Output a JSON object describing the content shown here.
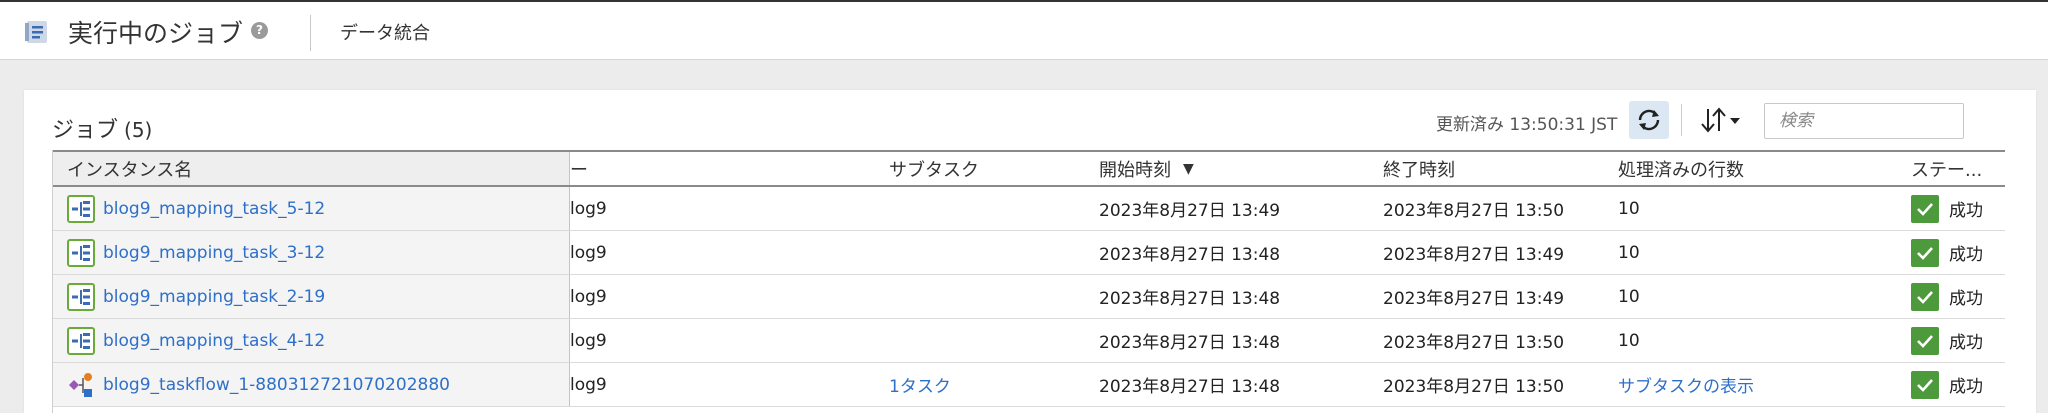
{
  "header": {
    "title": "実行中のジョブ",
    "help_icon": "?",
    "app_name": "データ統合"
  },
  "panel": {
    "title": "ジョブ",
    "count": "(5)",
    "updated": "更新済み 13:50:31 JST",
    "search_placeholder": "検索"
  },
  "columns": {
    "instance_name": "インスタンス名",
    "location": "ー",
    "subtask": "サブタスク",
    "start_time": "開始時刻",
    "end_time": "終了時刻",
    "rows_processed": "処理済みの行数",
    "status": "ステー..."
  },
  "rows": [
    {
      "name": "blog9_mapping_task_5-12",
      "location": "log9",
      "subtask": "",
      "start": "2023年8月27日 13:49",
      "end": "2023年8月27日 13:50",
      "rows": "10",
      "status": "成功",
      "icon": "mapping-task-icon"
    },
    {
      "name": "blog9_mapping_task_3-12",
      "location": "log9",
      "subtask": "",
      "start": "2023年8月27日 13:48",
      "end": "2023年8月27日 13:49",
      "rows": "10",
      "status": "成功",
      "icon": "mapping-task-icon"
    },
    {
      "name": "blog9_mapping_task_2-19",
      "location": "log9",
      "subtask": "",
      "start": "2023年8月27日 13:48",
      "end": "2023年8月27日 13:49",
      "rows": "10",
      "status": "成功",
      "icon": "mapping-task-icon"
    },
    {
      "name": "blog9_mapping_task_4-12",
      "location": "log9",
      "subtask": "",
      "start": "2023年8月27日 13:48",
      "end": "2023年8月27日 13:50",
      "rows": "10",
      "status": "成功",
      "icon": "mapping-task-icon"
    },
    {
      "name": "blog9_taskflow_1-880312721070202880",
      "location": "log9",
      "subtask": "1タスク",
      "start": "2023年8月27日 13:48",
      "end": "2023年8月27日 13:50",
      "rows": "サブタスクの表示",
      "status": "成功",
      "icon": "taskflow-icon"
    }
  ],
  "colors": {
    "link": "#2e6fc8",
    "success": "#4d9a3c",
    "mapping_icon": "#6aaa3a",
    "refresh_bg": "#dbe7f3"
  }
}
